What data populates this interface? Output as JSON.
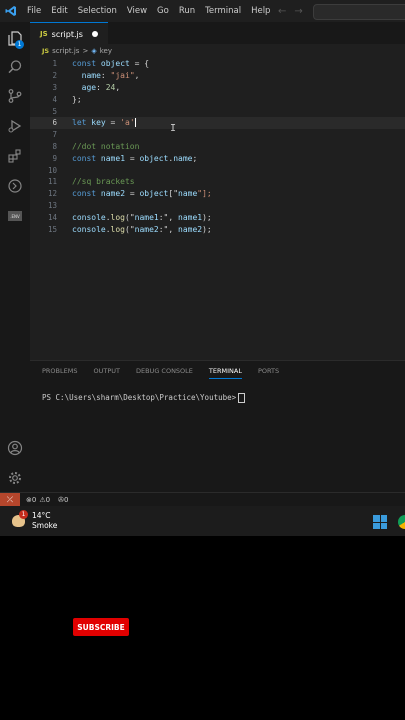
{
  "menu": [
    "File",
    "Edit",
    "Selection",
    "View",
    "Go",
    "Run",
    "Terminal",
    "Help"
  ],
  "tab": {
    "label": "script.js",
    "icon": "JS"
  },
  "breadcrumb": {
    "file": "script.js",
    "separator": ">",
    "symbol": "key"
  },
  "code": {
    "line_numbers": [
      "1",
      "2",
      "3",
      "4",
      "5",
      "6",
      "7",
      "8",
      "9",
      "10",
      "11",
      "12",
      "13",
      "14",
      "15"
    ],
    "active_line": 6,
    "lines": [
      "const object = {",
      "  name: \"jai\",",
      "  age: 24,",
      "};",
      "",
      "let key = 'a'",
      "",
      "//dot notation",
      "const name1 = object.name;",
      "",
      "//sq brackets",
      "const name2 = object[\"name\"];",
      "",
      "console.log(\"name1:\", name1);",
      "console.log(\"name2:\", name2);"
    ]
  },
  "panel": {
    "tabs": [
      "PROBLEMS",
      "OUTPUT",
      "DEBUG CONSOLE",
      "TERMINAL",
      "PORTS"
    ],
    "active_tab": "TERMINAL",
    "prompt": "PS C:\\Users\\sharm\\Desktop\\Practice\\Youtube>"
  },
  "activity_badge": "1",
  "status": {
    "errors": "0",
    "warnings": "0",
    "ports": "0"
  },
  "taskbar": {
    "temperature": "14°C",
    "condition": "Smoke",
    "weather_badge": "1"
  },
  "subscribe_label": "SUBSCRIBE",
  "colors": {
    "accent": "#0078d4",
    "remote": "#b5462c",
    "subscribe": "#e10000"
  }
}
